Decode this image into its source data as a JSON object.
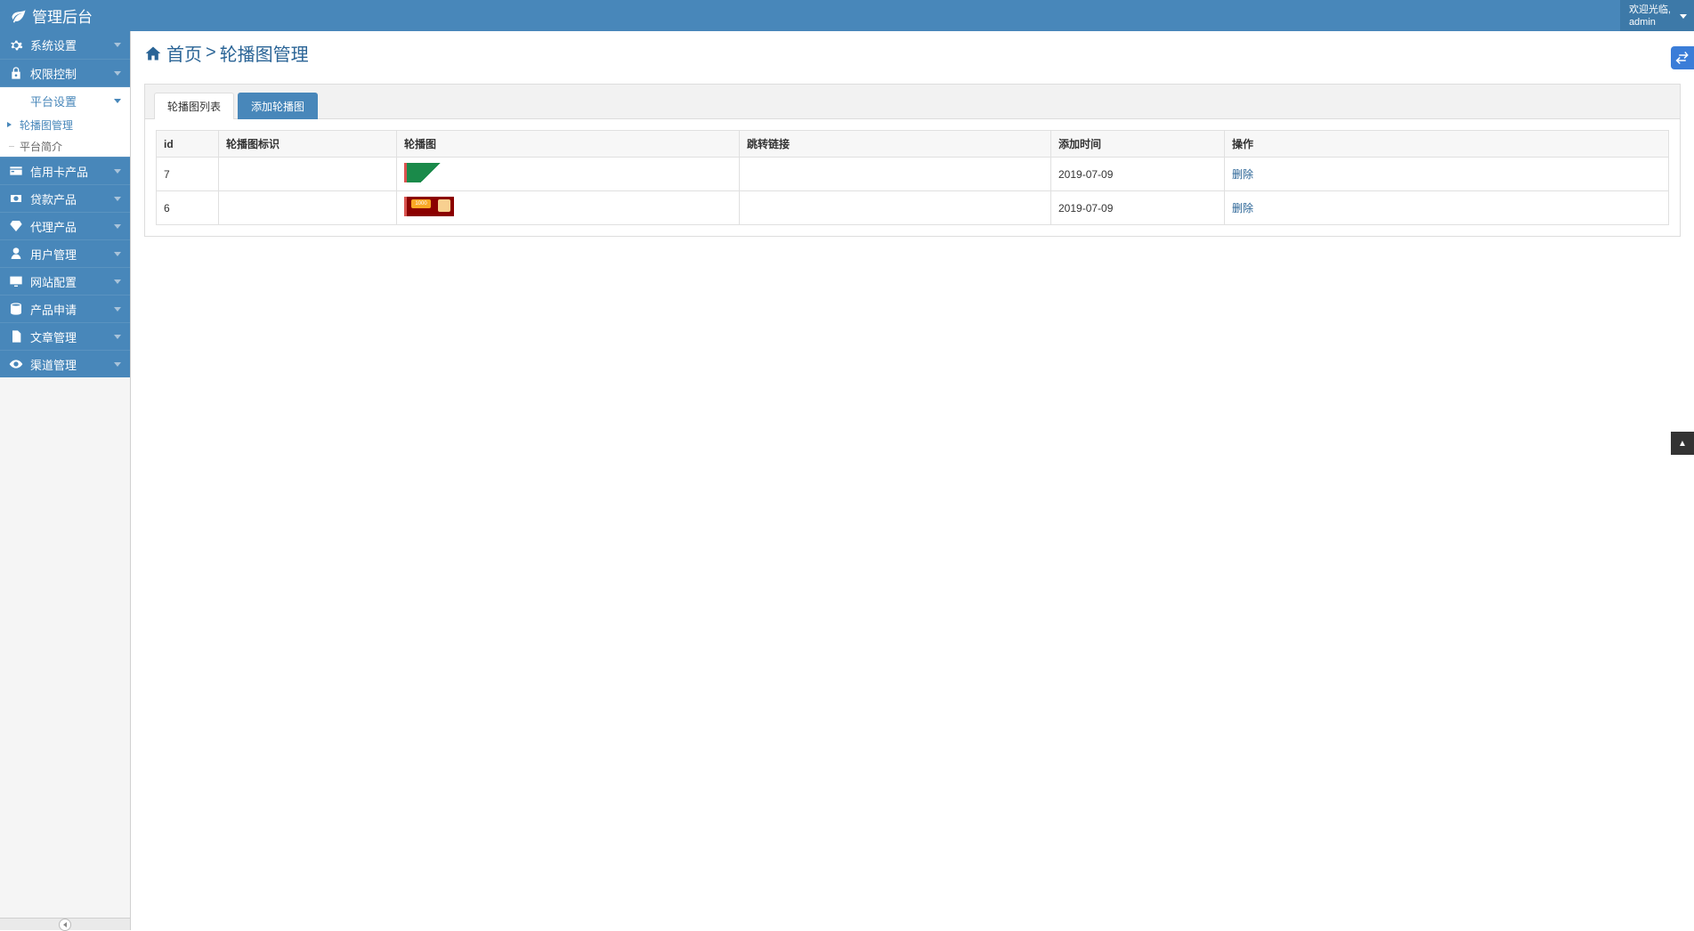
{
  "header": {
    "brand": "管理后台",
    "welcome": "欢迎光临,",
    "username": "admin"
  },
  "sidebar": {
    "items": [
      {
        "label": "系统设置",
        "icon": "gear"
      },
      {
        "label": "权限控制",
        "icon": "lock"
      },
      {
        "label": "平台设置",
        "icon": "card",
        "open": true,
        "sub": [
          {
            "label": "轮播图管理",
            "active": true
          },
          {
            "label": "平台简介",
            "active": false
          }
        ]
      },
      {
        "label": "信用卡产品",
        "icon": "credit"
      },
      {
        "label": "贷款产品",
        "icon": "money"
      },
      {
        "label": "代理产品",
        "icon": "diamond"
      },
      {
        "label": "用户管理",
        "icon": "user"
      },
      {
        "label": "网站配置",
        "icon": "monitor"
      },
      {
        "label": "产品申请",
        "icon": "database"
      },
      {
        "label": "文章管理",
        "icon": "document"
      },
      {
        "label": "渠道管理",
        "icon": "eye"
      }
    ]
  },
  "breadcrumb": {
    "home": "首页",
    "sep": ">",
    "current": "轮播图管理"
  },
  "tabs": {
    "list": "轮播图列表",
    "add": "添加轮播图"
  },
  "table": {
    "headers": {
      "id": "id",
      "ident": "轮播图标识",
      "img": "轮播图",
      "link": "跳转链接",
      "time": "添加时间",
      "ops": "操作"
    },
    "rows": [
      {
        "id": "7",
        "ident": "",
        "imgClass": "green",
        "link": "",
        "time": "2019-07-09",
        "del": "删除"
      },
      {
        "id": "6",
        "ident": "",
        "imgClass": "red",
        "link": "",
        "time": "2019-07-09",
        "del": "删除"
      }
    ]
  },
  "float": {
    "swap": "⇆",
    "up": "ꜛ"
  }
}
